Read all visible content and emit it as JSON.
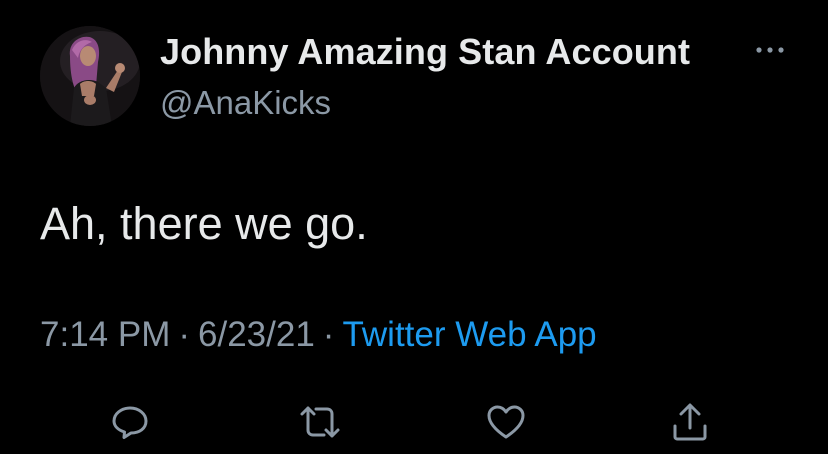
{
  "user": {
    "display_name": "Johnny Amazing Stan Account",
    "handle": "@AnaKicks",
    "avatar_icon": "profile-photo"
  },
  "tweet": {
    "text": "Ah, there we go.",
    "time": "7:14 PM",
    "separator": "·",
    "date": "6/23/21",
    "source": "Twitter Web App"
  },
  "actions": {
    "icons": [
      "reply-icon",
      "retweet-icon",
      "like-icon",
      "share-icon"
    ]
  },
  "colors": {
    "background": "#000000",
    "primary_text": "#e7e9ea",
    "secondary_text": "#8b98a5",
    "link": "#1d9bf0"
  }
}
